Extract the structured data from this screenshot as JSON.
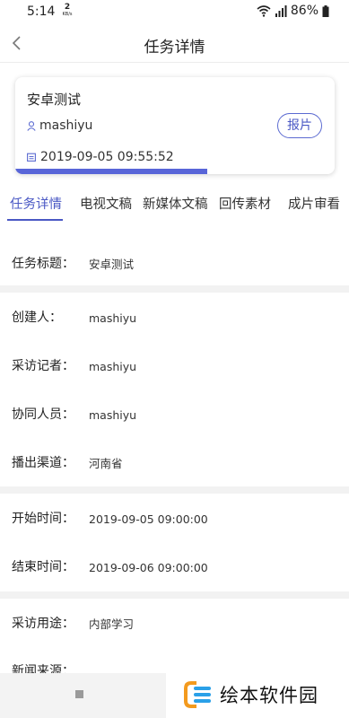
{
  "status": {
    "time": "5:14",
    "net_speed_value": "2",
    "net_speed_unit": "KB/s",
    "battery": "86%"
  },
  "header": {
    "title": "任务详情"
  },
  "card": {
    "title": "安卓测试",
    "user": "mashiyu",
    "datetime": "2019-09-05 09:55:52",
    "report_button": "报片",
    "progress": 0.6
  },
  "tabs": [
    {
      "label": "任务详情",
      "active": true
    },
    {
      "label": "电视文稿",
      "active": false
    },
    {
      "label": "新媒体文稿",
      "active": false
    },
    {
      "label": "回传素材",
      "active": false
    },
    {
      "label": "成片审看",
      "active": false
    }
  ],
  "details": {
    "task_title": {
      "label": "任务标题：",
      "value": "安卓测试"
    },
    "creator": {
      "label": "创建人：",
      "value": "mashiyu"
    },
    "reporter": {
      "label": "采访记者：",
      "value": "mashiyu"
    },
    "collaborators": {
      "label": "协同人员：",
      "value": "mashiyu"
    },
    "channel": {
      "label": "播出渠道：",
      "value": "河南省"
    },
    "start_time": {
      "label": "开始时间：",
      "value": "2019-09-05 09:00:00"
    },
    "end_time": {
      "label": "结束时间：",
      "value": "2019-09-06 09:00:00"
    },
    "purpose": {
      "label": "采访用途：",
      "value": "内部学习"
    },
    "news_source": {
      "label": "新闻来源：",
      "value": ""
    }
  },
  "watermark": {
    "text": "绘本软件园"
  },
  "colors": {
    "accent": "#4a58c4",
    "progress": "#5865d8",
    "divider": "#f2f2f2"
  }
}
